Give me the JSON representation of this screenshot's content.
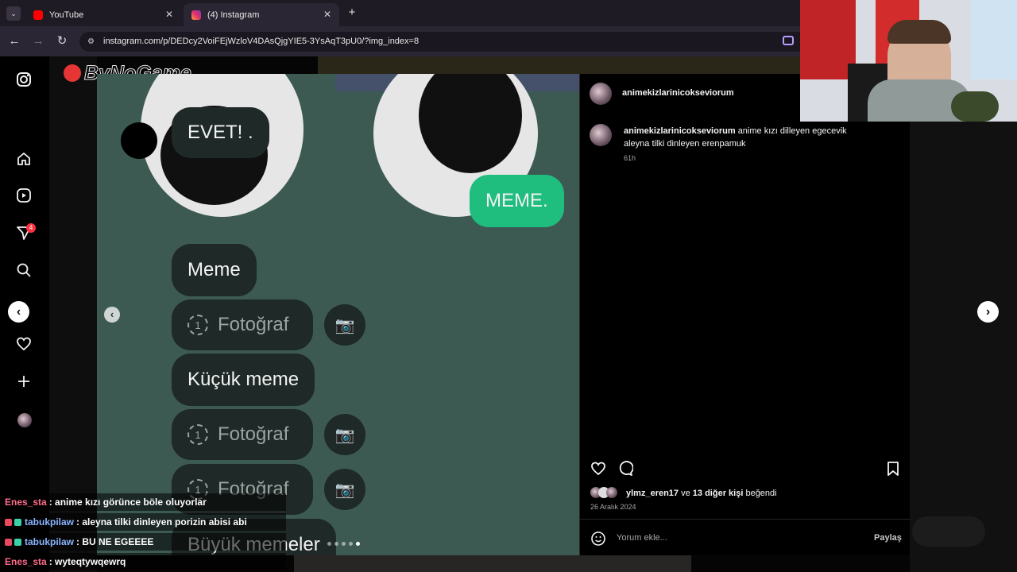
{
  "browser": {
    "tabs": [
      {
        "title": "YouTube",
        "favicon_color": "#ff0000",
        "active": false
      },
      {
        "title": "(4) Instagram",
        "favicon_color": "#e1306c",
        "active": true
      }
    ],
    "new_tab": "+",
    "url": "instagram.com/p/DEDcy2VoiFEjWzloV4DAsQjgYIE5-3YsAqT3pU0/?img_index=8"
  },
  "watermark": "ByNoGame",
  "nav": {
    "notifications_badge": "4",
    "icons": [
      "instagram-icon",
      "home-icon",
      "reels-icon",
      "send-icon",
      "search-icon",
      "explore-icon",
      "heart-icon",
      "plus-icon"
    ]
  },
  "media": {
    "bubble_evet": "EVET! .",
    "bubble_meme_sent": "MEME.",
    "bubble_meme": "Meme",
    "photo_count": "1",
    "photo_label": "Fotoğraf",
    "bubble_kucuk": "Küçük meme",
    "bubble_buyuk": "Büyük memeler",
    "sent_color": "#1fbd7e"
  },
  "post": {
    "author": "animekizlarinicokseviorum",
    "caption_user": "animekizlarinicokseviorum",
    "caption_line1": "anime kızı dilleyen egecevik",
    "caption_line2": "aleyna tilki dinleyen erenpamuk",
    "caption_time": "61h",
    "liked_by_user": "ylmz_eren17",
    "liked_by_and": "ve",
    "liked_by_others": "13 diğer kişi",
    "liked_by_suffix": "beğendi",
    "date": "26 Aralık 2024",
    "comment_placeholder": "Yorum ekle...",
    "share": "Paylaş"
  },
  "chat": [
    {
      "user": "Enes_sta",
      "user_color": "#ff6b8a",
      "badges": false,
      "message": ": anime kızı görünce böle oluyorlar"
    },
    {
      "user": "tabukpilaw",
      "user_color": "#8ab4ff",
      "badges": true,
      "message": ": aleyna tilki dinleyen porizin abisi abi"
    },
    {
      "user": "tabukpilaw",
      "user_color": "#8ab4ff",
      "badges": true,
      "message": ": BU NE EGEEEE"
    },
    {
      "user": "Enes_sta",
      "user_color": "#ff6b8a",
      "badges": false,
      "message": ": wyteqtywqewrq"
    }
  ]
}
